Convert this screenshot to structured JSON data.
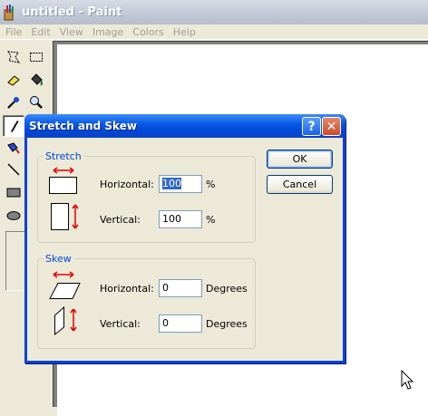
{
  "window": {
    "title": "untitled - Paint"
  },
  "menubar": {
    "items": [
      "File",
      "Edit",
      "View",
      "Image",
      "Colors",
      "Help"
    ]
  },
  "toolbox": {
    "tools": [
      {
        "icon": "free-form-select-icon"
      },
      {
        "icon": "rect-select-icon"
      },
      {
        "icon": "eraser-icon"
      },
      {
        "icon": "fill-bucket-icon"
      },
      {
        "icon": "eyedropper-icon"
      },
      {
        "icon": "magnifier-icon"
      },
      {
        "icon": "pencil-icon",
        "pressed": true
      },
      {
        "icon": "brush-icon"
      },
      {
        "icon": "airbrush-icon"
      },
      {
        "icon": "line-icon"
      },
      {
        "icon": "rectangle-icon"
      },
      {
        "icon": "ellipse-icon"
      }
    ]
  },
  "dialog": {
    "title": "Stretch and Skew",
    "help_btn": "?",
    "close_btn": "✕",
    "stretch": {
      "legend": "Stretch",
      "horizontal_label": "Horizontal:",
      "horizontal_value": "100",
      "horizontal_unit": "%",
      "vertical_label": "Vertical:",
      "vertical_value": "100",
      "vertical_unit": "%"
    },
    "skew": {
      "legend": "Skew",
      "horizontal_label": "Horizontal:",
      "horizontal_value": "0",
      "horizontal_unit": "Degrees",
      "vertical_label": "Vertical:",
      "vertical_value": "0",
      "vertical_unit": "Degrees"
    },
    "ok_label": "OK",
    "cancel_label": "Cancel"
  },
  "colors": {
    "accent": "#0046d5",
    "arrow_red": "#e00000"
  }
}
